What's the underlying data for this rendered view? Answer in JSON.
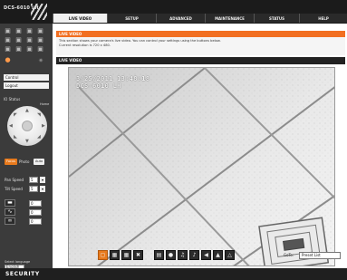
{
  "header": {
    "model": "DCS-6010 LH",
    "tabs": [
      "LIVE VIDEO",
      "SETUP",
      "ADVANCED",
      "MAINTENANCE",
      "STATUS",
      "HELP"
    ]
  },
  "sidebar": {
    "control_label": "Control",
    "logout_label": "Logout",
    "sub_label": "IO Status",
    "home_label": "Home",
    "focus_label": "Focus",
    "auto_label": "Auto",
    "photo_label": "Photo",
    "pan_speed_label": "Pan Speed",
    "pan_speed_value": "5",
    "tilt_speed_label": "Tilt Speed",
    "tilt_speed_value": "5",
    "ctrl_values": [
      "0",
      "0",
      "0"
    ],
    "language_label": "Select language",
    "language_value": "English"
  },
  "content": {
    "info_title": "LIVE VIDEO",
    "info_line1": "This section shows your camera's live video. You can control your settings using the buttons below.",
    "info_line2": "Current resolution is 720 x 480.",
    "live_header": "LIVE VIDEO",
    "osd_date": "3/25/2011  13:48:18",
    "osd_name": "DCS-6010 LH"
  },
  "toolbar": {
    "goto_label": "GoTo:",
    "goto_value": "Preset List"
  },
  "footer": {
    "security": "SECURITY"
  },
  "colors": {
    "accent_orange": "#f26f21",
    "dark_bg": "#1b1b1b",
    "sidebar_bg": "#3b3b3b"
  }
}
